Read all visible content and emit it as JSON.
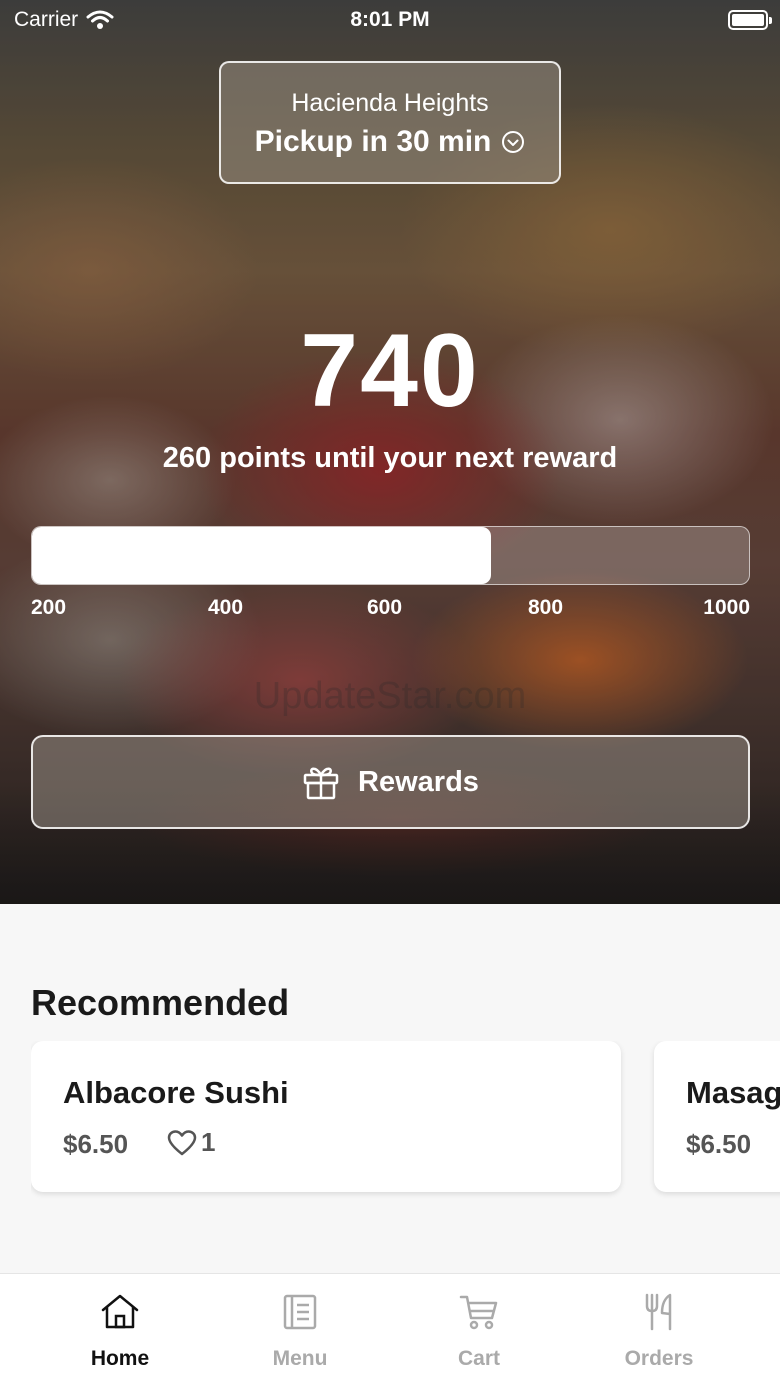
{
  "status_bar": {
    "carrier": "Carrier",
    "time": "8:01 PM"
  },
  "location": {
    "name": "Hacienda Heights",
    "pickup": "Pickup in 30 min"
  },
  "loyalty": {
    "points": "740",
    "caption": "260 points until your next reward",
    "progress_fraction": 0.64,
    "ticks": [
      "200",
      "400",
      "600",
      "800",
      "1000"
    ]
  },
  "watermark": "UpdateStar.com",
  "rewards_button": {
    "label": "Rewards"
  },
  "recommended": {
    "title": "Recommended",
    "items": [
      {
        "name": "Albacore Sushi",
        "price": "$6.50",
        "likes": "1"
      },
      {
        "name": "Masago",
        "price": "$6.50"
      }
    ]
  },
  "tabs": [
    {
      "label": "Home",
      "icon": "home-icon",
      "active": true
    },
    {
      "label": "Menu",
      "icon": "menu-icon",
      "active": false
    },
    {
      "label": "Cart",
      "icon": "cart-icon",
      "active": false
    },
    {
      "label": "Orders",
      "icon": "orders-icon",
      "active": false
    }
  ],
  "colors": {
    "active_tab": "#111111",
    "inactive_tab": "#aaaaaa",
    "text_secondary": "#555555"
  }
}
